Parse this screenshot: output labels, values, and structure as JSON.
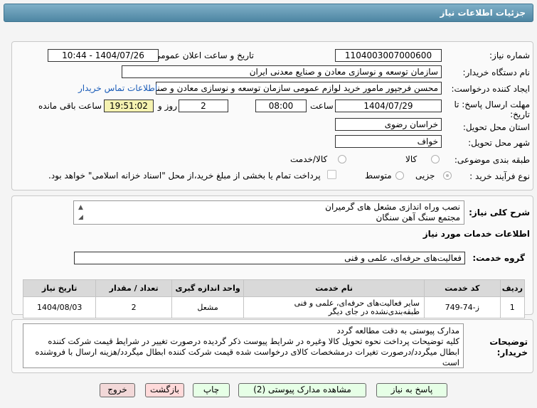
{
  "header": {
    "title": "جزئیات اطلاعات نیاز"
  },
  "fields": {
    "need_number_label": "شماره نیاز:",
    "need_number": "1104003007000600",
    "announce_label": "تاریخ و ساعت اعلان عمومی:",
    "announce_value": "1404/07/26 - 10:44",
    "buyer_org_label": "نام دستگاه خریدار:",
    "buyer_org": "سازمان توسعه و نوسازی معادن و صنایع معدنی ایران",
    "creator_label": "ایجاد کننده درخواست:",
    "creator": "محسن فرجپور مامور خرید لوازم عمومی سازمان توسعه و نوسازی معادن و صنایع معدنی ایران",
    "contact_link": "اطلاعات تماس خریدار",
    "deadline_label": "مهلت ارسال پاسخ: تا تاریخ:",
    "deadline_date": "1404/07/29",
    "time_label": "ساعت",
    "deadline_time": "08:00",
    "days_count": "2",
    "days_label": "روز و",
    "remaining_time": "19:51:02",
    "remaining_label": "ساعت باقی مانده",
    "province_label": "استان محل تحویل:",
    "province": "خراسان رضوی",
    "city_label": "شهر محل تحویل:",
    "city": "خواف",
    "category_label": "طبقه بندی موضوعی:",
    "category_options": [
      "کالا",
      "کالا/خدمت"
    ],
    "process_label": "نوع فرآیند خرید :",
    "process_options": [
      "جزیی",
      "متوسط"
    ],
    "payment_note": "پرداخت تمام یا بخشی از مبلغ خرید،از محل \"اسناد خزانه اسلامی\" خواهد بود."
  },
  "description": {
    "label": "شرح کلی نیاز:",
    "line1": "نصب وراه اندازی مشعل های گرمیران",
    "line2": "مجتمع سنگ آهن سنگان"
  },
  "services": {
    "section_title": "اطلاعات خدمات مورد نیاز",
    "group_label": "گروه خدمت:",
    "group_value": "فعالیت‌های حرفه‌ای، علمی و فنی",
    "table": {
      "headers": [
        "ردیف",
        "کد خدمت",
        "نام خدمت",
        "واحد اندازه گیری",
        "تعداد / مقدار",
        "تاریخ نیاز"
      ],
      "rows": [
        [
          "1",
          "ز-74-749",
          "سایر فعالیت‌های حرفه‌ای، علمی و فنی طبقه‌بندی‌نشده در جای دیگر",
          "مشعل",
          "2",
          "1404/08/03"
        ]
      ]
    }
  },
  "buyer_notes": {
    "label": "توضیحات خریدار:",
    "text": "مدارک پیوستی به دقت مطالعه گردد\nکلیه توضیحات پرداخت نحوه تحویل کالا وغیره در شرایط پیوست ذکر گردیده درصورت تغییر در شرایط  قیمت شرکت کننده ابطال میگردد/درصورت تغیرات درمشخصات کالای درخواست شده قیمت شرکت کننده ابطال میگردد/هزینه ارسال با فروشنده است"
  },
  "buttons": {
    "reply": "پاسخ به نیاز",
    "attachments": "مشاهده مدارک پیوستی (2)",
    "print": "چاپ",
    "back": "بازگشت",
    "exit": "خروج"
  }
}
